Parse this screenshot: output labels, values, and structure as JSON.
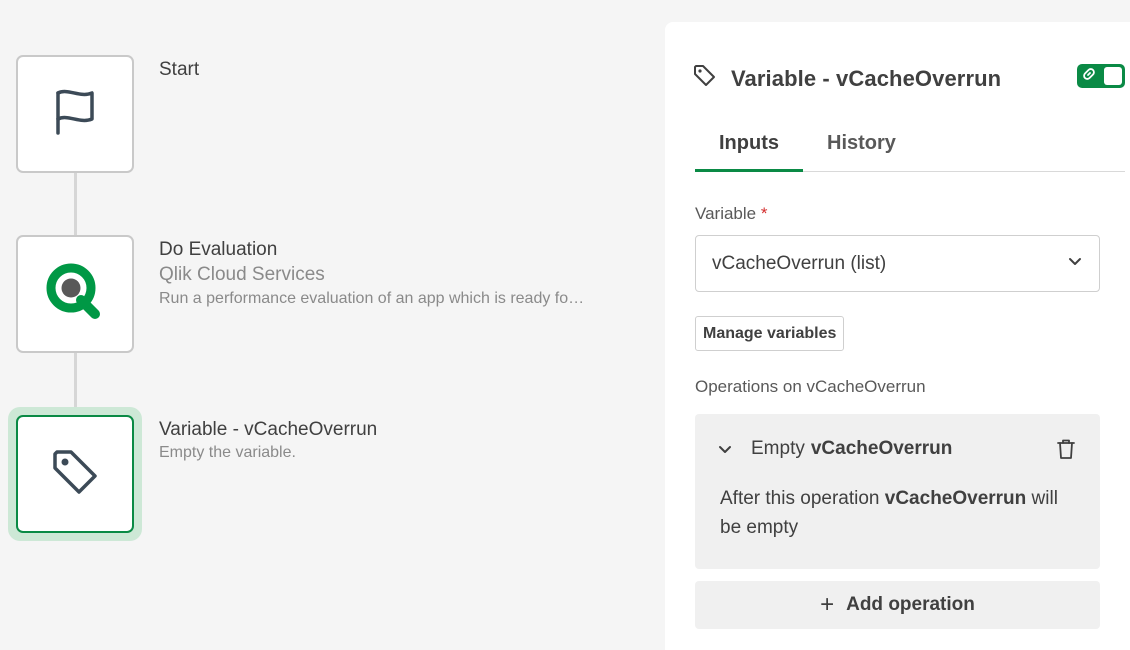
{
  "flow": {
    "nodes": [
      {
        "title": "Start",
        "icon": "flag-icon"
      },
      {
        "title": "Do Evaluation",
        "subtitle": "Qlik Cloud Services",
        "description": "Run a performance evaluation of an app which is ready fo…",
        "icon": "qlik-logo-icon"
      },
      {
        "title": "Variable - vCacheOverrun",
        "description": "Empty the variable.",
        "icon": "tag-icon",
        "selected": true
      }
    ]
  },
  "panel": {
    "title": "Variable - vCacheOverrun",
    "icon": "tag-icon",
    "toggle_icon": "link-icon",
    "tabs": [
      {
        "label": "Inputs",
        "active": true
      },
      {
        "label": "History",
        "active": false
      }
    ],
    "variable_label": "Variable",
    "required_mark": "*",
    "variable_value": "vCacheOverrun (list)",
    "manage_label": "Manage variables",
    "operations_label": "Operations on vCacheOverrun",
    "operation": {
      "action": "Empty",
      "variable": "vCacheOverrun",
      "desc_pre": "After this operation ",
      "desc_var": "vCacheOverrun",
      "desc_post": " will be empty"
    },
    "add_operation_label": "Add operation",
    "add_symbol": "+"
  },
  "colors": {
    "accent": "#0a8a45",
    "qlik_green": "#009845",
    "halo": "#cde8d6"
  }
}
